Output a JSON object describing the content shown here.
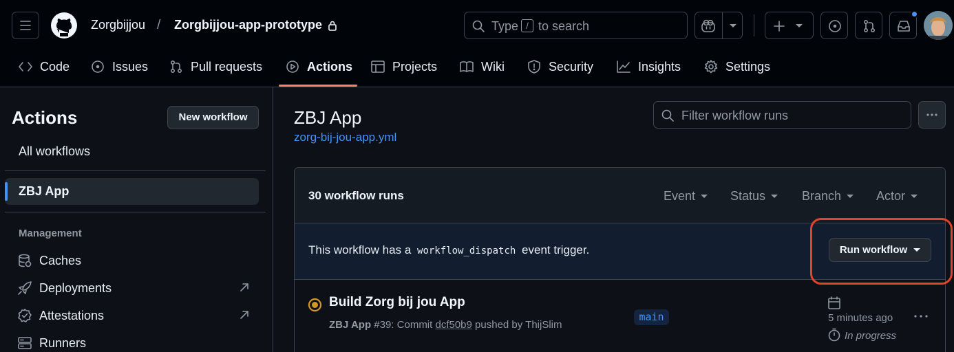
{
  "header": {
    "owner": "Zorgbijjou",
    "separator": "/",
    "repo": "Zorgbijjou-app-prototype",
    "search": {
      "prefix": "Type",
      "key": "/",
      "suffix": "to search"
    }
  },
  "tabs": [
    {
      "label": "Code"
    },
    {
      "label": "Issues"
    },
    {
      "label": "Pull requests"
    },
    {
      "label": "Actions"
    },
    {
      "label": "Projects"
    },
    {
      "label": "Wiki"
    },
    {
      "label": "Security"
    },
    {
      "label": "Insights"
    },
    {
      "label": "Settings"
    }
  ],
  "sidebar": {
    "title": "Actions",
    "new_workflow": "New workflow",
    "all_workflows": "All workflows",
    "selected_workflow": "ZBJ App",
    "management_heading": "Management",
    "management_items": [
      {
        "label": "Caches",
        "icon": "database-icon"
      },
      {
        "label": "Deployments",
        "icon": "rocket-icon"
      },
      {
        "label": "Attestations",
        "icon": "verified-icon"
      },
      {
        "label": "Runners",
        "icon": "server-icon"
      }
    ]
  },
  "main": {
    "title": "ZBJ App",
    "file_link": "zorg-bij-jou-app.yml",
    "filter_placeholder": "Filter workflow runs",
    "runs_count": "30 workflow runs",
    "filters": [
      "Event",
      "Status",
      "Branch",
      "Actor"
    ],
    "dispatch_prefix": "This workflow has a",
    "dispatch_code": "workflow_dispatch",
    "dispatch_suffix": "event trigger.",
    "run_workflow": "Run workflow"
  },
  "run": {
    "title": "Build Zorg bij jou App",
    "workflow": "ZBJ App",
    "number": "#39: Commit",
    "commit": "dcf50b9",
    "pushed_by": "pushed by ThijSlim",
    "branch": "main",
    "time": "5 minutes ago",
    "status": "In progress"
  },
  "colors": {
    "accent_link": "#4493f8",
    "tab_underline": "#f78166",
    "in_progress": "#d29922",
    "highlight": "#e0452a"
  }
}
